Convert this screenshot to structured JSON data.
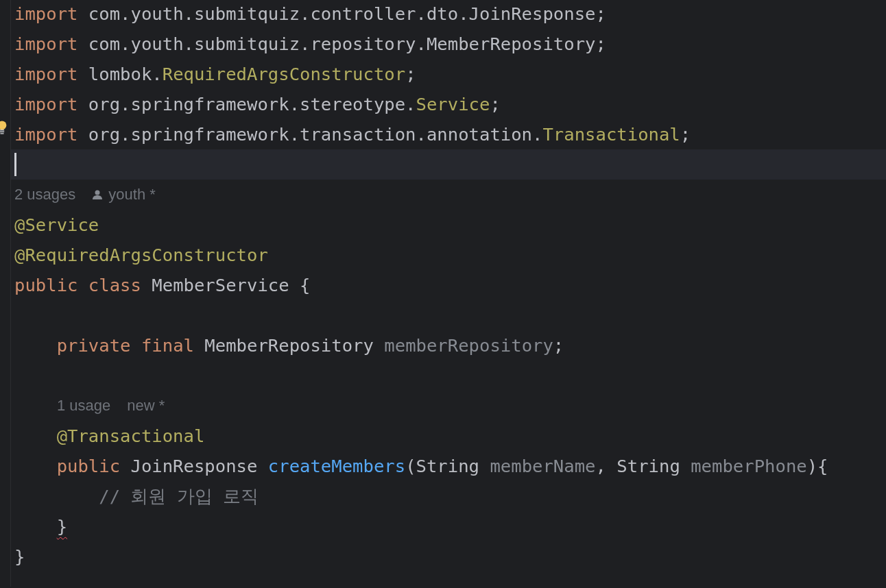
{
  "editor": {
    "lines": [
      {
        "kind": "code",
        "tokens": [
          {
            "kind": "keyword",
            "text": "import"
          },
          {
            "kind": "plain",
            "text": " com.youth.submitquiz.controller.dto.JoinResponse;"
          }
        ]
      },
      {
        "kind": "code",
        "tokens": [
          {
            "kind": "keyword",
            "text": "import"
          },
          {
            "kind": "plain",
            "text": " com.youth.submitquiz.repository.MemberRepository;"
          }
        ]
      },
      {
        "kind": "code",
        "tokens": [
          {
            "kind": "keyword",
            "text": "import"
          },
          {
            "kind": "plain",
            "text": " lombok."
          },
          {
            "kind": "annotation",
            "text": "RequiredArgsConstructor"
          },
          {
            "kind": "plain",
            "text": ";"
          }
        ]
      },
      {
        "kind": "code",
        "tokens": [
          {
            "kind": "keyword",
            "text": "import"
          },
          {
            "kind": "plain",
            "text": " org.springframework.stereotype."
          },
          {
            "kind": "annotation",
            "text": "Service"
          },
          {
            "kind": "plain",
            "text": ";"
          }
        ]
      },
      {
        "kind": "code",
        "bulb": true,
        "tokens": [
          {
            "kind": "keyword",
            "text": "import"
          },
          {
            "kind": "plain",
            "text": " org.springframework.transaction.annotation."
          },
          {
            "kind": "annotation",
            "text": "Transactional"
          },
          {
            "kind": "plain",
            "text": ";"
          }
        ]
      },
      {
        "kind": "code",
        "current": true
      },
      {
        "kind": "inlay",
        "hints": [
          {
            "kind": "usage",
            "text": "2 usages"
          },
          {
            "kind": "author",
            "text": "youth *"
          }
        ]
      },
      {
        "kind": "code",
        "tokens": [
          {
            "kind": "annotation",
            "text": "@Service"
          }
        ]
      },
      {
        "kind": "code",
        "tokens": [
          {
            "kind": "annotation",
            "text": "@RequiredArgsConstructor"
          }
        ]
      },
      {
        "kind": "code",
        "tokens": [
          {
            "kind": "keyword",
            "text": "public"
          },
          {
            "kind": "keyword",
            "text": " class"
          },
          {
            "kind": "plain",
            "text": " MemberService {"
          }
        ]
      },
      {
        "kind": "code"
      },
      {
        "kind": "code",
        "tokens": [
          {
            "kind": "keyword",
            "text": "    private"
          },
          {
            "kind": "keyword",
            "text": " final"
          },
          {
            "kind": "plain",
            "text": " MemberRepository "
          },
          {
            "kind": "field",
            "text": "memberRepository"
          },
          {
            "kind": "plain",
            "text": ";"
          }
        ]
      },
      {
        "kind": "code"
      },
      {
        "kind": "inlay",
        "indent": true,
        "hints": [
          {
            "kind": "usage",
            "text": "1 usage"
          },
          {
            "kind": "plain",
            "text": "new *"
          }
        ]
      },
      {
        "kind": "code",
        "tokens": [
          {
            "kind": "annotation",
            "text": "    @Transactional"
          }
        ]
      },
      {
        "kind": "code",
        "tokens": [
          {
            "kind": "keyword",
            "text": "    public"
          },
          {
            "kind": "plain",
            "text": " JoinResponse "
          },
          {
            "kind": "method",
            "text": "createMembers"
          },
          {
            "kind": "plain",
            "text": "(String "
          },
          {
            "kind": "field",
            "text": "memberName"
          },
          {
            "kind": "plain",
            "text": ", String "
          },
          {
            "kind": "field",
            "text": "memberPhone"
          },
          {
            "kind": "plain",
            "text": "){"
          }
        ]
      },
      {
        "kind": "code",
        "tokens": [
          {
            "kind": "comment",
            "text": "        // 회원 가입 로직"
          }
        ]
      },
      {
        "kind": "code",
        "tokens": [
          {
            "kind": "plain",
            "text": "    }",
            "error": true
          }
        ]
      },
      {
        "kind": "code",
        "tokens": [
          {
            "kind": "plain",
            "text": "}"
          }
        ]
      }
    ]
  }
}
